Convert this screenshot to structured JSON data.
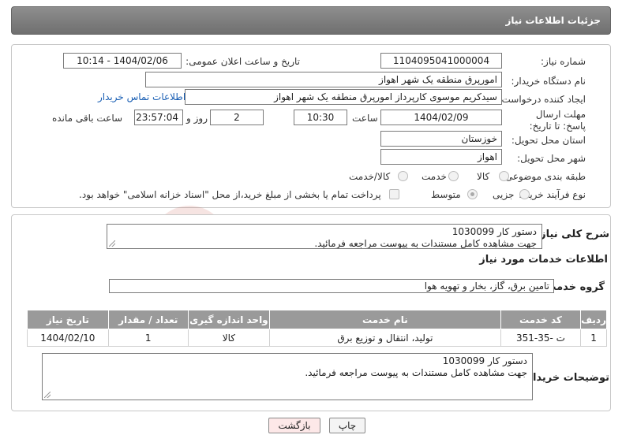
{
  "header": {
    "title": "جزئیات اطلاعات نیاز"
  },
  "form": {
    "need_number_label": "شماره نیاز:",
    "need_number": "1104095041000004",
    "announce_label": "تاریخ و ساعت اعلان عمومی:",
    "announce_value": "1404/02/06 - 10:14",
    "buyer_org_label": "نام دستگاه خریدار:",
    "buyer_org": "امورپرق منطقه یک شهر اهواز",
    "creator_label": "ایجاد کننده درخواست:",
    "creator": "سیدکریم موسوی کارپرداز امورپرق منطقه یک شهر اهواز",
    "contact_link": "اطلاعات تماس خریدار",
    "deadline_label": "مهلت ارسال پاسخ: تا تاریخ:",
    "deadline_date": "1404/02/09",
    "time_label": "ساعت",
    "deadline_time": "10:30",
    "days_value": "2",
    "days_label": "روز و",
    "remaining_time": "23:57:04",
    "remaining_label": "ساعت باقی مانده",
    "province_label": "استان محل تحویل:",
    "province": "خوزستان",
    "city_label": "شهر محل تحویل:",
    "city": "اهواز",
    "category_label": "طبقه بندی موضوعی:",
    "category_options": [
      "کالا",
      "خدمت",
      "کالا/خدمت"
    ],
    "process_label": "نوع فرآیند خرید :",
    "process_options": [
      "جزیی",
      "متوسط"
    ],
    "payment_note": "پرداخت تمام یا بخشی از مبلغ خرید،از محل \"اسناد خزانه اسلامی\" خواهد بود."
  },
  "description": {
    "label": "شرح کلی نیاز:",
    "line1": "دستور کار 1030099",
    "line2": "جهت مشاهده کامل مستندات به پیوست مراجعه فرمائید."
  },
  "services": {
    "title": "اطلاعات خدمات مورد نیاز",
    "group_label": "گروه خدمت:",
    "group_value": "تامین برق، گاز، بخار و تهویه هوا",
    "columns": [
      "ردیف",
      "کد خدمت",
      "نام خدمت",
      "واحد اندازه گیری",
      "تعداد / مقدار",
      "تاریخ نیاز"
    ],
    "rows": [
      [
        "1",
        "ت -35-351",
        "تولید، انتقال و توزیع برق",
        "کالا",
        "1",
        "1404/02/10"
      ]
    ]
  },
  "buyer_notes": {
    "label": "توضیحات خریدار:",
    "line1": "دستور کار 1030099",
    "line2": "جهت مشاهده کامل مستندات به پیوست مراجعه فرمائید."
  },
  "buttons": {
    "print": "چاپ",
    "back": "بازگشت"
  },
  "watermark_text": "AriaTender.neT",
  "colors": {
    "header": "#7f7f7f",
    "link": "#1a5fb4",
    "back_button": "#fde8e8",
    "watermark": "#c0392b"
  }
}
